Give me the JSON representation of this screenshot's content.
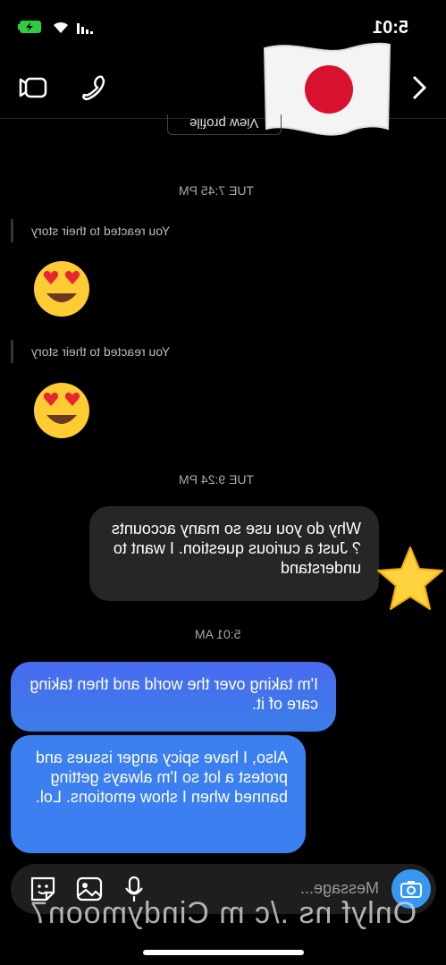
{
  "status": {
    "time": "5:01"
  },
  "header": {
    "view_profile": "View profile"
  },
  "thread": {
    "ts1": "TUE 7:45 PM",
    "react1": "You reacted to their story",
    "react2": "You reacted to their story",
    "ts2": "TUE 9:24 PM",
    "sent1": "Why do you use so many accounts ? Just a curious question. I want to understand",
    "ts3": "5:01 AM",
    "recv1": "I'm taking over the world and then taking care of it.",
    "recv2": "Also, I have spicy anger issues and protest a lot so I'm always getting banned when I show emotions. Lol."
  },
  "composer": {
    "placeholder": "Message..."
  },
  "watermark": "Onlyf ns ./c m Cindymoon7",
  "colors": {
    "accent": "#3797f0",
    "bubble_blue": "#4a6bf0",
    "bubble_grey": "#262626"
  },
  "icons": [
    "battery-charging-icon",
    "wifi-icon",
    "signal-icon",
    "video-call-icon",
    "phone-icon",
    "japan-flag-icon",
    "chevron-right-icon",
    "heart-eyes-emoji-icon",
    "star-emoji-icon",
    "camera-icon",
    "sticker-icon",
    "gallery-icon",
    "microphone-icon"
  ]
}
